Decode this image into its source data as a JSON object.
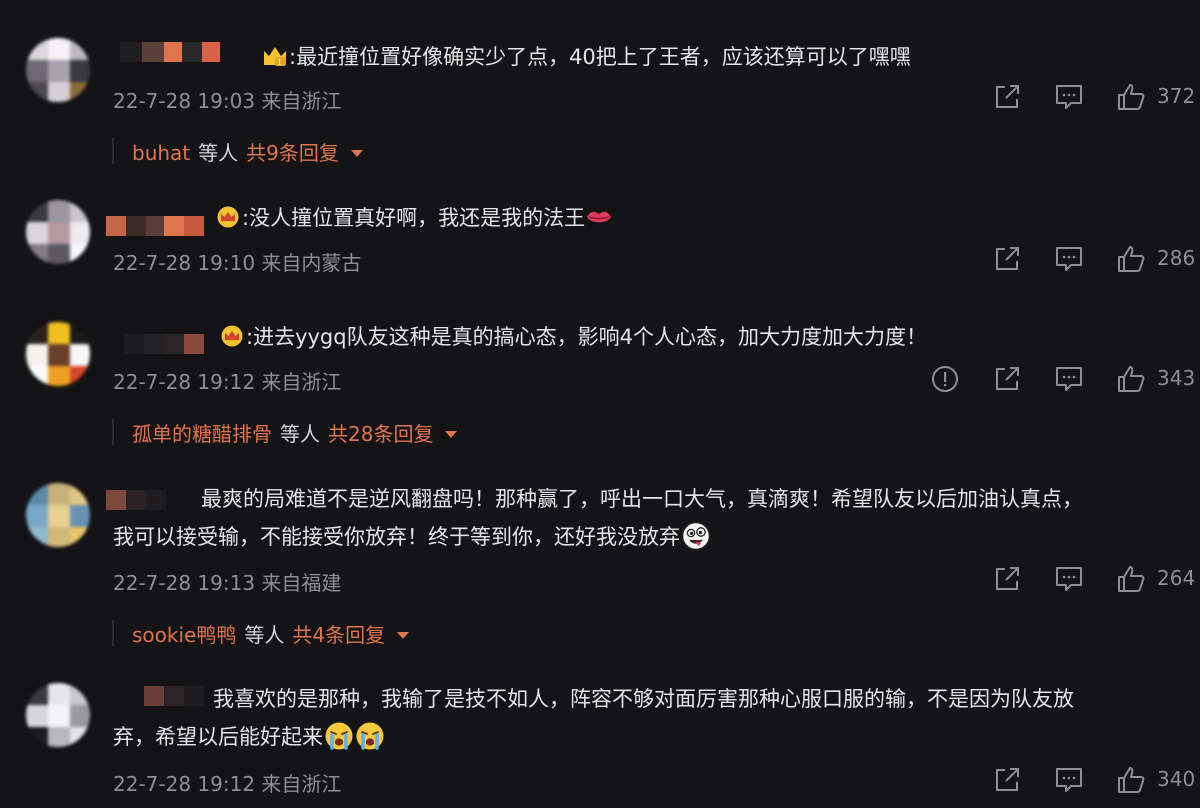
{
  "comments": [
    {
      "text": ":最近撞位置好像确实少了点，40把上了王者，应该还算可以了嘿嘿",
      "timestamp": "22-7-28 19:03",
      "location": "来自浙江",
      "likes": "372",
      "badge_icon": "vip-badge-icon",
      "replies": {
        "name": "buhat",
        "middle": "等人",
        "total": "共9条回复"
      }
    },
    {
      "text": ":没人撞位置真好啊，我还是我的法王",
      "timestamp": "22-7-28 19:10",
      "location": "来自内蒙古",
      "likes": "286",
      "badge_icon": "crown-icon",
      "emoji": "lips-emoji"
    },
    {
      "text": ":进去yygq队友这种是真的搞心态，影响4个人心态，加大力度加大力度！",
      "timestamp": "22-7-28 19:12",
      "location": "来自浙江",
      "likes": "343",
      "badge_icon": "crown-icon",
      "report_icon": "report-icon",
      "replies": {
        "name": "孤单的糖醋排骨",
        "middle": "等人",
        "total": "共28条回复"
      }
    },
    {
      "line1": "最爽的局难道不是逆风翻盘吗！那种赢了，呼出一口大气，真滴爽！希望队友以后加油认真点，",
      "line2": "我可以接受输，不能接受你放弃！终于等到你，还好我没放弃",
      "timestamp": "22-7-28 19:13",
      "location": "来自福建",
      "likes": "264",
      "emoji": "crazy-face-emoji",
      "replies": {
        "name": "sookie鸭鸭",
        "middle": "等人",
        "total": "共4条回复"
      }
    },
    {
      "line1": "我喜欢的是那种，我输了是技不如人，阵容不够对面厉害那种心服口服的输，不是因为队友放",
      "line2": "弃，希望以后能好起来",
      "timestamp": "22-7-28 19:12",
      "location": "来自浙江",
      "likes": "340",
      "emoji": "crying-emoji"
    }
  ],
  "icons": {
    "share": "share-icon",
    "comment": "comment-icon",
    "like": "thumbs-up-icon"
  },
  "colors": {
    "background": "#141416",
    "accent": "#e0744c",
    "meta": "#8e8e93",
    "text": "#e4e4e6"
  }
}
